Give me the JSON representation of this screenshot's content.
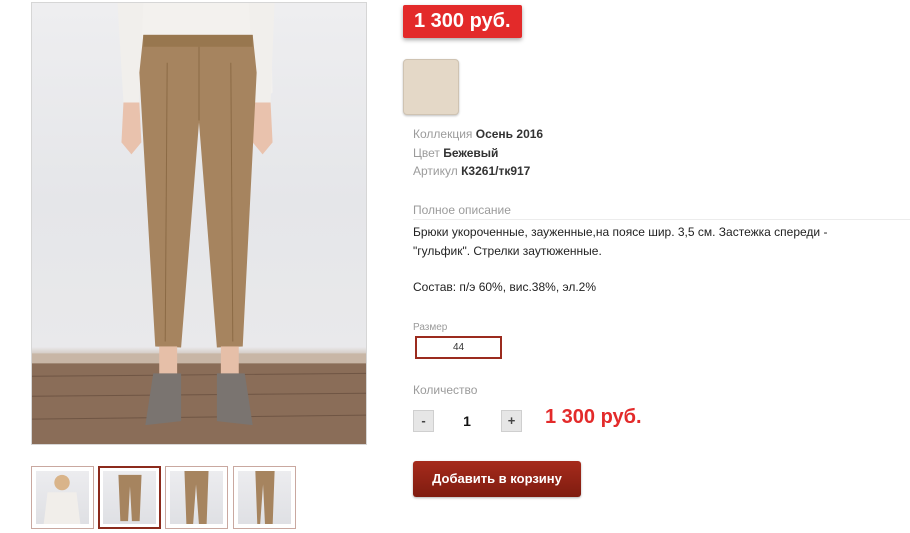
{
  "product": {
    "price_badge": "1 300 руб.",
    "swatch_color": "#e4d8c7",
    "details": [
      {
        "label": "Коллекция",
        "value": "Осень 2016"
      },
      {
        "label": "Цвет",
        "value": "Бежевый"
      },
      {
        "label": "Артикул",
        "value": "К3261/тк917"
      }
    ],
    "description_label": "Полное описание",
    "description": "Брюки укороченные, зауженные,на поясе шир. 3,5 см. Застежка спереди - \"гульфик\". Стрелки заутюженные.",
    "composition": "Состав: п/э 60%, вис.38%, эл.2%",
    "size_label": "Размер",
    "size_value": "44",
    "quantity_label": "Количество",
    "qty_minus": "-",
    "qty_value": "1",
    "qty_plus": "+",
    "total_price": "1 300 руб.",
    "add_to_cart": "Добавить в корзину"
  },
  "colors": {
    "accent_red": "#e32a2a",
    "button_dark_red": "#8b2a1c"
  }
}
